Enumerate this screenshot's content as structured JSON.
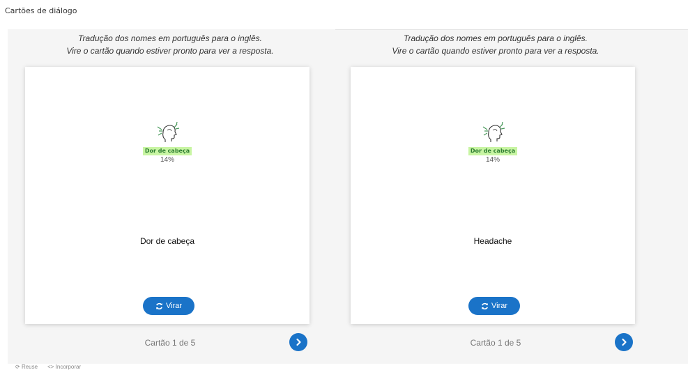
{
  "page": {
    "title": "Cartões de diálogo"
  },
  "dialogs": [
    {
      "instructions_line1": "Tradução dos nomes em português para o inglês.",
      "instructions_line2": "Vire o cartão quando estiver pronto para ver a resposta.",
      "image_label": "Dor de cabeça",
      "image_percent": "14%",
      "card_text": "Dor de cabeça",
      "flip_label": "Virar",
      "counter": "Cartão 1 de 5"
    },
    {
      "instructions_line1": "Tradução dos nomes em português para o inglês.",
      "instructions_line2": "Vire o cartão quando estiver pronto para ver a resposta.",
      "image_label": "Dor de cabeça",
      "image_percent": "14%",
      "card_text": "Headache",
      "flip_label": "Virar",
      "counter": "Cartão 1 de 5"
    }
  ],
  "footer": {
    "reuse": "Reuse",
    "embed": "Incorporar"
  },
  "icons": {
    "flip": "refresh-icon",
    "next": "chevron-right-icon",
    "image": "headache-head-icon"
  },
  "colors": {
    "accent": "#1a73c8",
    "label_bg": "#c8f5a3"
  }
}
